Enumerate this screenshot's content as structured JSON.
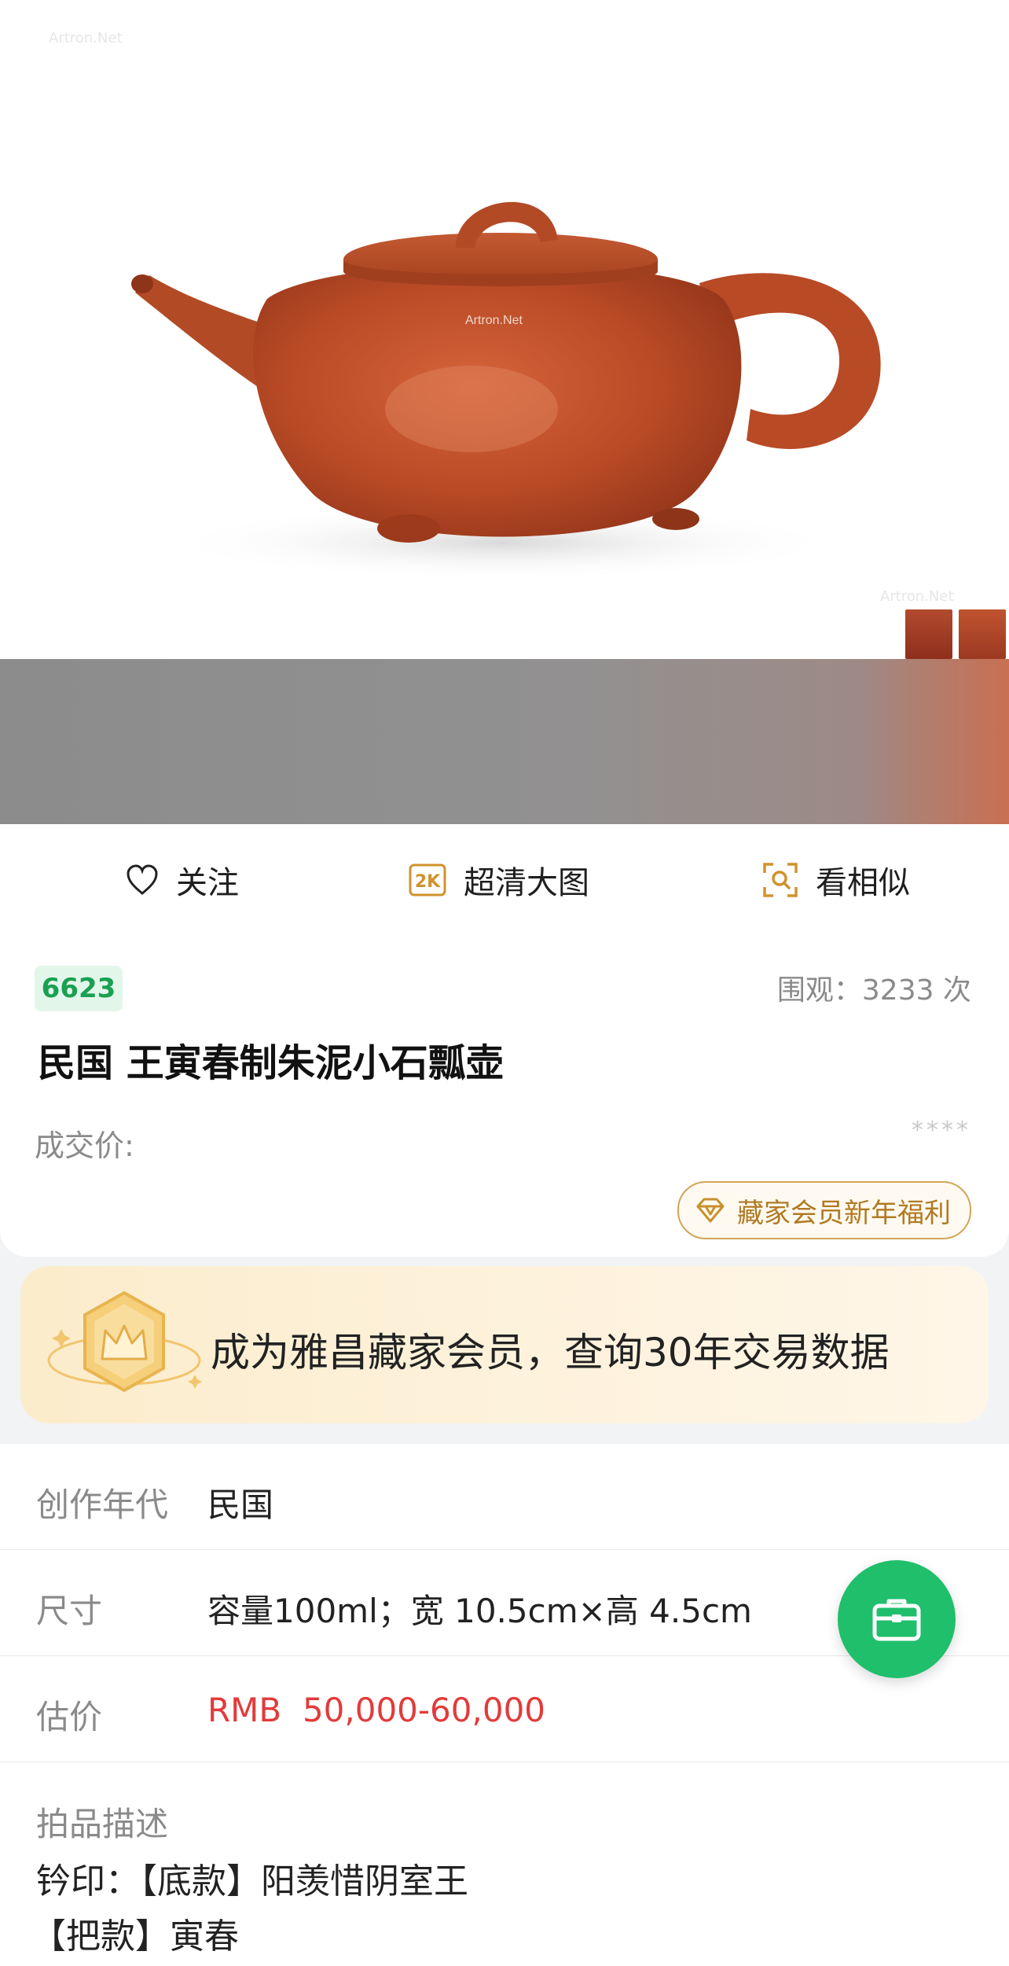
{
  "hero": {
    "watermark": "Artron.Net"
  },
  "actions": {
    "follow_label": "关注",
    "hd_badge": "2K",
    "hd_label": "超清大图",
    "similar_label": "看相似"
  },
  "lot": {
    "number": "6623",
    "views_label": "围观：",
    "views_count": "3233",
    "views_unit": "次",
    "title": "民国 王寅春制朱泥小石瓢壶",
    "price_label": "成交价:",
    "price_masked": "****",
    "member_pill_label": "藏家会员新年福利"
  },
  "promo": {
    "text": "成为雅昌藏家会员，查询30年交易数据"
  },
  "details": {
    "era_label": "创作年代",
    "era_value": "民国",
    "size_label": "尺寸",
    "size_value": "容量100ml；宽 10.5cm×高 4.5cm",
    "estimate_label": "估价",
    "estimate_currency": "RMB",
    "estimate_value": "50,000-60,000",
    "description_label": "拍品描述",
    "description_line1": "钤印：【底款】阳羡惜阴室王",
    "description_line2": "【把款】寅春"
  },
  "colors": {
    "accent_green": "#1fbf6b",
    "estimate_red": "#e23b3b",
    "gold": "#b07a22"
  }
}
